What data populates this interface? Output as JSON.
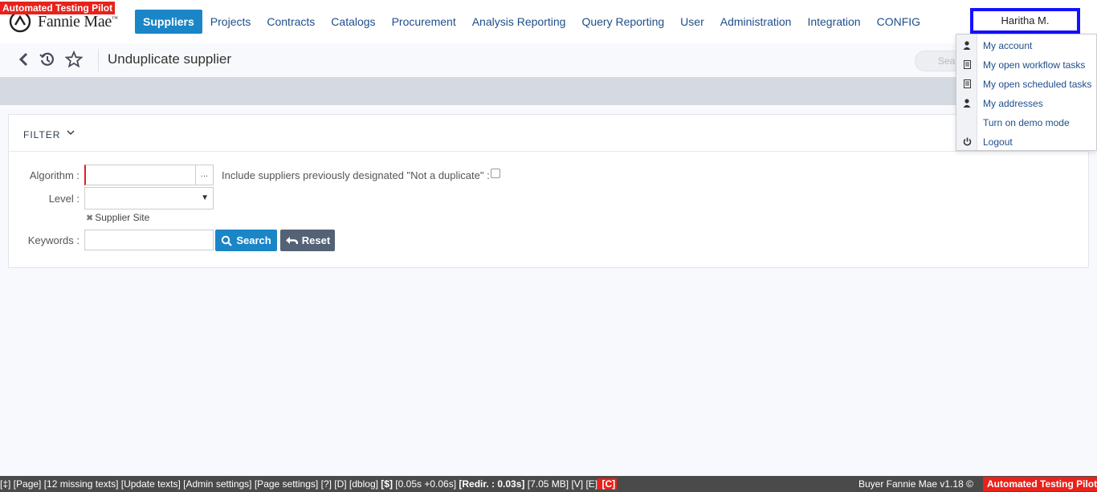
{
  "overlay_badge": "Automated Testing Pilot",
  "brand": {
    "name": "Fannie Mae",
    "tm": "™"
  },
  "nav": {
    "items": [
      "Suppliers",
      "Projects",
      "Contracts",
      "Catalogs",
      "Procurement",
      "Analysis Reporting",
      "Query Reporting",
      "User",
      "Administration",
      "Integration",
      "CONFIG"
    ],
    "active": "Suppliers"
  },
  "user": {
    "name": "Haritha M."
  },
  "user_menu": [
    {
      "label": "My account",
      "icon": "person-icon"
    },
    {
      "label": "My open workflow tasks",
      "icon": "document-icon"
    },
    {
      "label": "My open scheduled tasks",
      "icon": "document-icon"
    },
    {
      "label": "My addresses",
      "icon": "person-icon"
    },
    {
      "label": "Turn on demo mode",
      "icon": ""
    },
    {
      "label": "Logout",
      "icon": "power-icon"
    }
  ],
  "page": {
    "title": "Unduplicate supplier",
    "search_placeholder": "Sea"
  },
  "filter": {
    "header": "FILTER",
    "algorithm_label": "Algorithm :",
    "algorithm_value": "",
    "algorithm_btn": "...",
    "include_label": "Include suppliers previously designated \"Not a duplicate\" :",
    "include_checked": false,
    "level_label": "Level :",
    "level_value": "",
    "level_chip": "Supplier Site",
    "keywords_label": "Keywords :",
    "keywords_value": "",
    "search_btn": "Search",
    "reset_btn": "Reset"
  },
  "footer": {
    "debug_items": [
      {
        "t": "[‡]",
        "s": ""
      },
      {
        "t": " [Page]",
        "s": ""
      },
      {
        "t": " [12 missing texts]",
        "s": ""
      },
      {
        "t": " [Update texts]",
        "s": ""
      },
      {
        "t": " [Admin settings]",
        "s": ""
      },
      {
        "t": " [Page settings]",
        "s": ""
      },
      {
        "t": " [?]",
        "s": ""
      },
      {
        "t": " [D]",
        "s": ""
      },
      {
        "t": " [dblog]",
        "s": ""
      },
      {
        "t": " [$]",
        "s": "b"
      },
      {
        "t": " [0.05s +0.06s]",
        "s": ""
      },
      {
        "t": " [Redir. : 0.03s]",
        "s": "b"
      },
      {
        "t": " [7.05 MB]",
        "s": ""
      },
      {
        "t": " [V]",
        "s": ""
      },
      {
        "t": " [E]",
        "s": ""
      },
      {
        "t": " [C]",
        "s": "red"
      }
    ],
    "version": "Buyer Fannie Mae v1.18 ©",
    "pilot": "Automated Testing Pilot"
  }
}
